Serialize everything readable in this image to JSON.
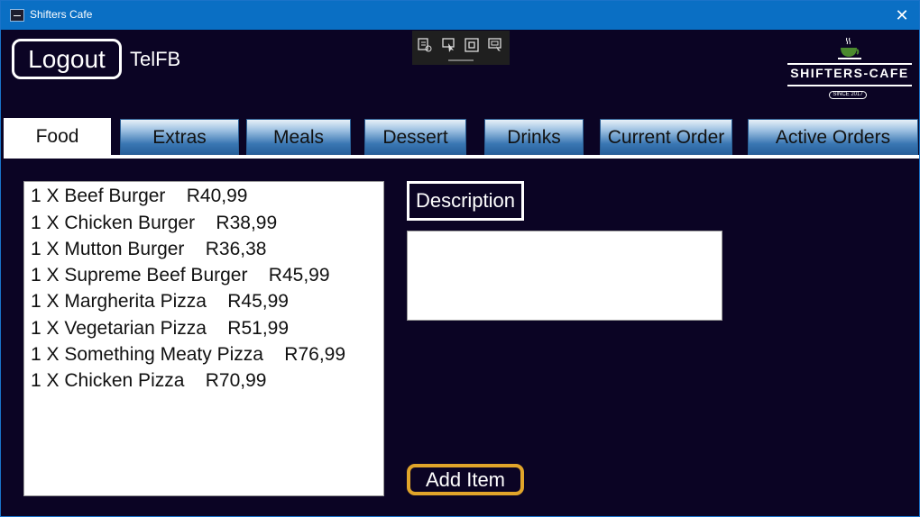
{
  "window": {
    "title": "Shifters Cafe",
    "close_glyph": "✕"
  },
  "header": {
    "logout_label": "Logout",
    "username": "TelFB",
    "logo": {
      "brand": "SHIFTERS-CAFE",
      "since": "SINCE 2017"
    }
  },
  "tabs": [
    {
      "label": "Food",
      "active": true
    },
    {
      "label": "Extras",
      "active": false
    },
    {
      "label": "Meals",
      "active": false
    },
    {
      "label": "Dessert",
      "active": false
    },
    {
      "label": "Drinks",
      "active": false
    },
    {
      "label": "Current Order",
      "active": false
    },
    {
      "label": "Active Orders",
      "active": false
    }
  ],
  "menu_items": [
    "1 X Beef Burger    R40,99",
    "1 X Chicken Burger    R38,99",
    "1 X Mutton Burger    R36,38",
    "1 X Supreme Beef Burger    R45,99",
    "1 X Margherita Pizza    R45,99",
    "1 X Vegetarian Pizza    R51,99",
    "1 X Something Meaty Pizza    R76,99",
    "1 X Chicken Pizza    R70,99"
  ],
  "description": {
    "label": "Description",
    "text": ""
  },
  "actions": {
    "add_item_label": "Add Item"
  },
  "colors": {
    "background": "#0b0424",
    "titlebar": "#0a6fc4",
    "accent_border": "#e1a52a",
    "tab_gradient_dark": "#27609b"
  }
}
